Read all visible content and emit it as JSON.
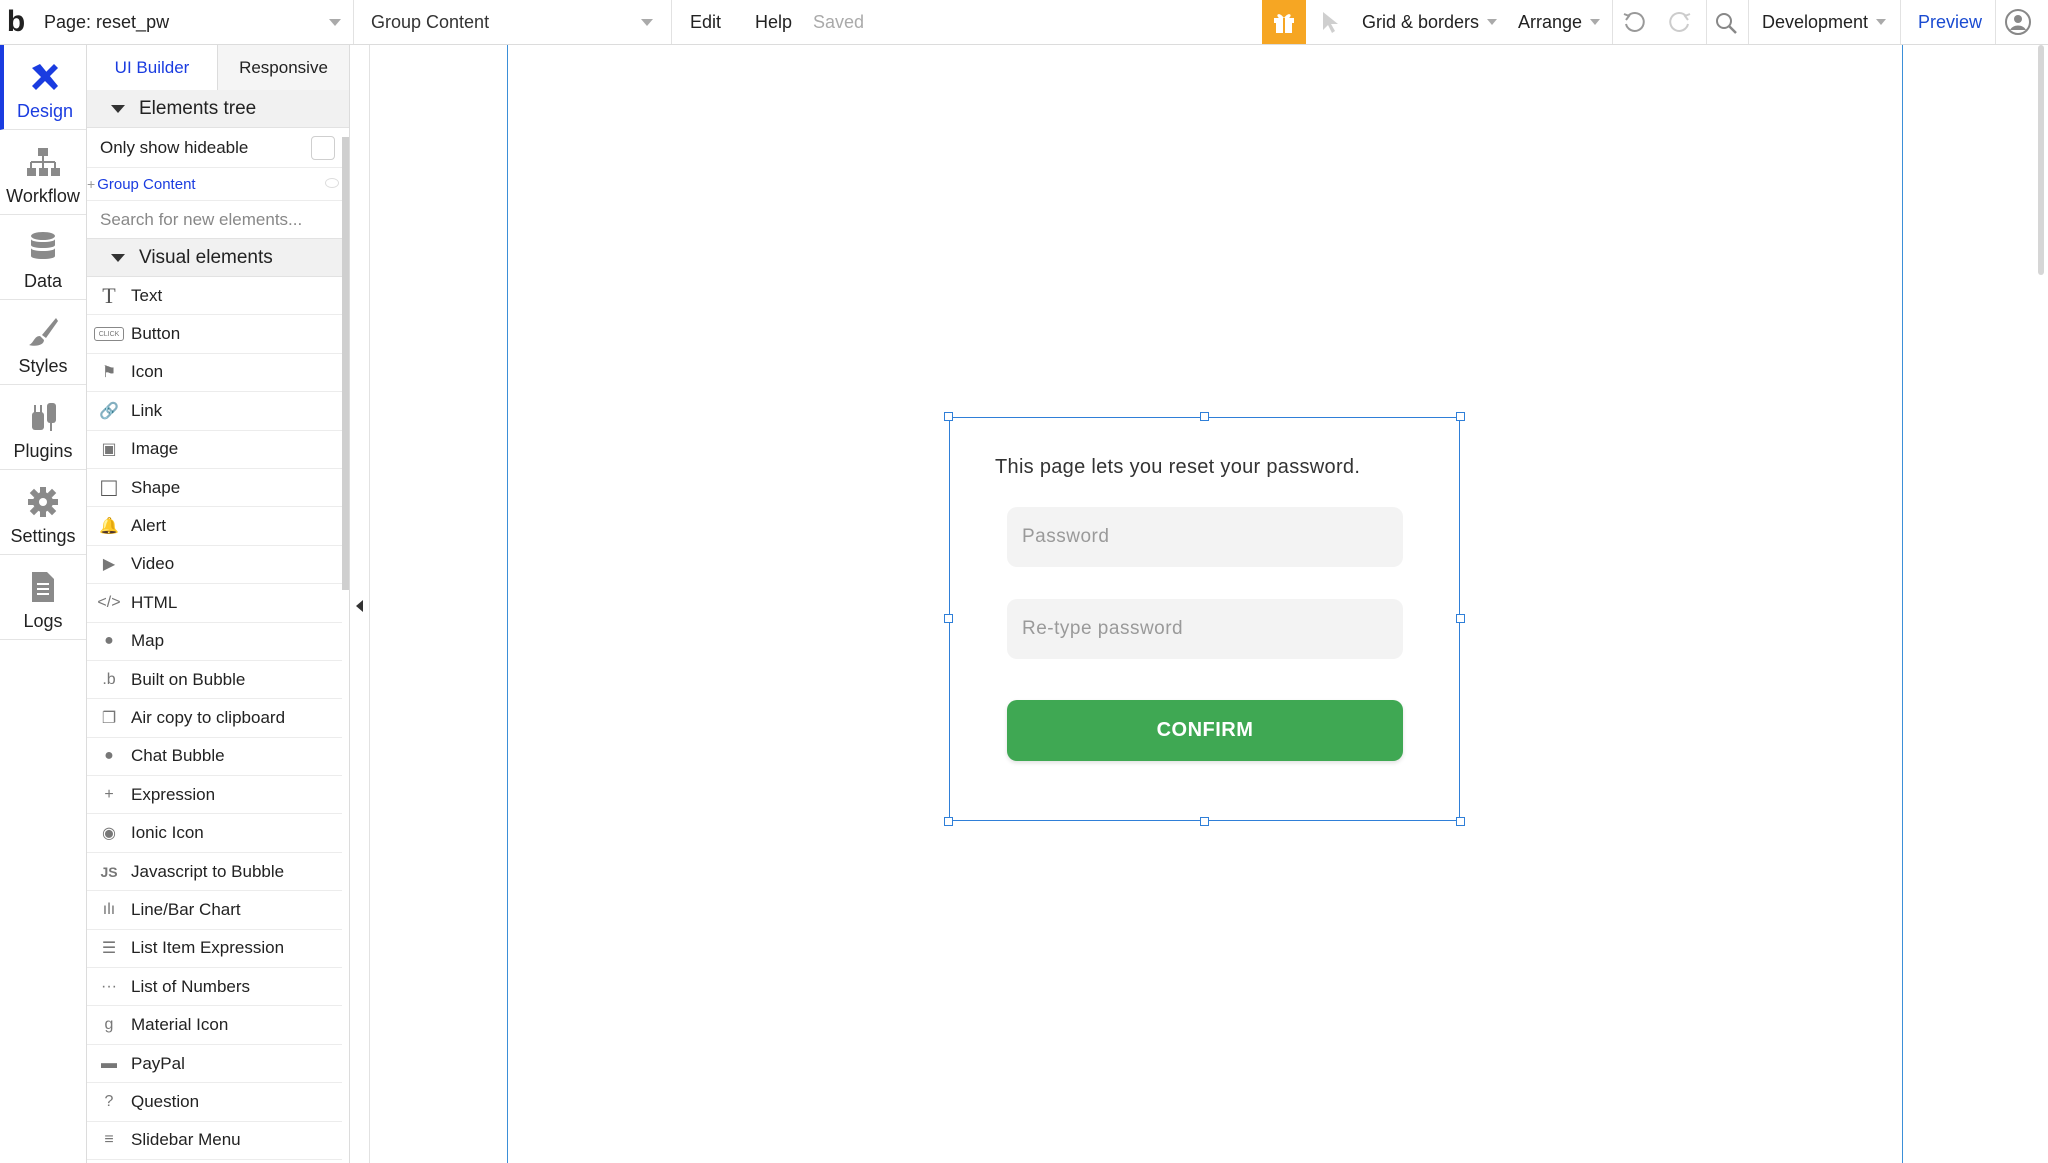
{
  "topbar": {
    "logo": "b",
    "page_selector": "Page: reset_pw",
    "element_selector": "Group Content",
    "menu_edit": "Edit",
    "menu_help": "Help",
    "save_status": "Saved",
    "grid_borders": "Grid & borders",
    "arrange": "Arrange",
    "version": "Development",
    "preview": "Preview",
    "accent_color": "#f6a623",
    "icons": [
      "gift-icon",
      "select-cursor-icon",
      "undo-icon",
      "redo-icon",
      "search-icon",
      "user-avatar-icon"
    ]
  },
  "rail": {
    "items": [
      {
        "label": "Design",
        "icon": "design-icon",
        "active": true
      },
      {
        "label": "Workflow",
        "icon": "workflow-icon"
      },
      {
        "label": "Data",
        "icon": "database-icon"
      },
      {
        "label": "Styles",
        "icon": "brush-icon"
      },
      {
        "label": "Plugins",
        "icon": "plug-icon"
      },
      {
        "label": "Settings",
        "icon": "gear-icon"
      },
      {
        "label": "Logs",
        "icon": "document-icon"
      }
    ]
  },
  "panel": {
    "tabs": [
      "UI Builder",
      "Responsive"
    ],
    "elements_tree": "Elements tree",
    "only_show_hideable": "Only show hideable",
    "group_content": "Group Content",
    "search_placeholder": "Search for new elements...",
    "visual_elements": "Visual elements",
    "items": [
      {
        "label": "Text",
        "icon": "T"
      },
      {
        "label": "Button",
        "icon": "CLICK"
      },
      {
        "label": "Icon",
        "icon": "⚑"
      },
      {
        "label": "Link",
        "icon": "🔗"
      },
      {
        "label": "Image",
        "icon": "▣"
      },
      {
        "label": "Shape",
        "icon": "□"
      },
      {
        "label": "Alert",
        "icon": "🔔"
      },
      {
        "label": "Video",
        "icon": "▶"
      },
      {
        "label": "HTML",
        "icon": "</>"
      },
      {
        "label": "Map",
        "icon": "●"
      },
      {
        "label": "Built on Bubble",
        "icon": ".b"
      },
      {
        "label": "Air copy to clipboard",
        "icon": "❐"
      },
      {
        "label": "Chat Bubble",
        "icon": "●"
      },
      {
        "label": "Expression",
        "icon": "+"
      },
      {
        "label": "Ionic Icon",
        "icon": "◉"
      },
      {
        "label": "Javascript to Bubble",
        "icon": "JS"
      },
      {
        "label": "Line/Bar Chart",
        "icon": "ılı"
      },
      {
        "label": "List Item Expression",
        "icon": "☰"
      },
      {
        "label": "List of Numbers",
        "icon": "···"
      },
      {
        "label": "Material Icon",
        "icon": "g"
      },
      {
        "label": "PayPal",
        "icon": "▬"
      },
      {
        "label": "Question",
        "icon": "?"
      },
      {
        "label": "Slidebar Menu",
        "icon": "≡"
      }
    ]
  },
  "canvas": {
    "description_text": "This page lets you reset your password.",
    "password_placeholder": "Password",
    "retype_placeholder": "Re-type password",
    "confirm_label": "CONFIRM",
    "button_color": "#3fa853",
    "selection_color": "#2f7fd8"
  }
}
